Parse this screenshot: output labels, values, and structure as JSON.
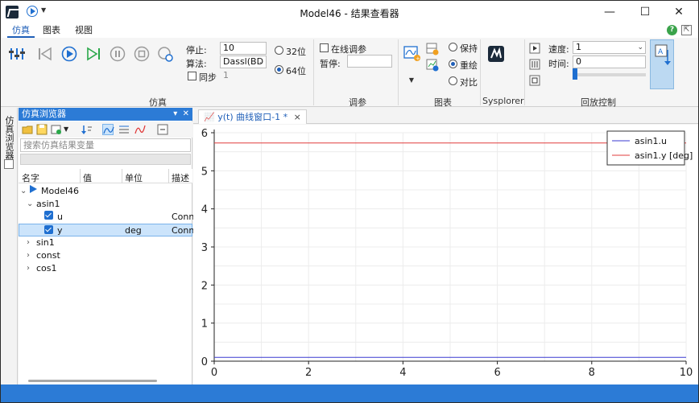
{
  "window": {
    "title": "Model46 - 结果查看器"
  },
  "title_buttons": {
    "minimize": "—",
    "maximize": "☐",
    "close": "✕"
  },
  "tabs": [
    {
      "label": "仿真",
      "active": true
    },
    {
      "label": "图表",
      "active": false
    },
    {
      "label": "视图",
      "active": false
    }
  ],
  "sim_group": {
    "label": "仿真",
    "stop_label": "停止:",
    "stop_value": "10",
    "algo_label": "算法:",
    "algo_value": "Dassl(BD",
    "sync_label": "同步",
    "sync_value": "1",
    "bit32_label": "32位",
    "bit64_label": "64位",
    "selected_bits": "64位"
  },
  "tune_group": {
    "label": "调参",
    "online_label": "在线调参",
    "pause_label": "暂停:"
  },
  "chart_group": {
    "label": "图表",
    "keep_label": "保持",
    "redraw_label": "重绘",
    "compare_label": "对比",
    "selected_mode": "重绘"
  },
  "sysplorer_group": {
    "label": "Sysplorer"
  },
  "replay_group": {
    "label": "回放控制",
    "speed_label": "速度:",
    "speed_value": "1",
    "time_label": "时间:",
    "time_value": "0",
    "time_progress": 0.0
  },
  "side_strip": {
    "label": "仿真浏览器"
  },
  "browser": {
    "title": "仿真浏览器",
    "search_placeholder": "搜索仿真结果变量",
    "columns": [
      "名字",
      "值",
      "单位",
      "描述"
    ],
    "rows": [
      {
        "name": "Model46",
        "value": "",
        "unit": "",
        "desc": "",
        "level": 0,
        "expanded": true
      },
      {
        "name": "asin1",
        "value": "",
        "unit": "",
        "desc": "",
        "level": 1,
        "expanded": true
      },
      {
        "name": "u",
        "value": "",
        "unit": "",
        "desc": "Conn",
        "level": 2,
        "checked": true
      },
      {
        "name": "y",
        "value": "",
        "unit": "deg",
        "desc": "Conn",
        "level": 2,
        "checked": true,
        "selected": true
      },
      {
        "name": "sin1",
        "level": 1,
        "expanded": false
      },
      {
        "name": "const",
        "level": 1,
        "expanded": false
      },
      {
        "name": "cos1",
        "level": 1,
        "expanded": false
      }
    ]
  },
  "plot_tab": {
    "label": "y(t) 曲线窗口-1 *",
    "close": "×"
  },
  "chart_data": {
    "type": "line",
    "xlim": [
      0,
      10
    ],
    "ylim": [
      0,
      6
    ],
    "xticks": [
      0,
      2,
      4,
      6,
      8,
      10
    ],
    "yticks": [
      0,
      1,
      2,
      3,
      4,
      5,
      6
    ],
    "grid": true,
    "legend_position": "top-right",
    "series": [
      {
        "name": "asin1.u",
        "color": "#3a3ad0",
        "x": [
          0,
          10
        ],
        "y": [
          0.1,
          0.1
        ]
      },
      {
        "name": "asin1.y [deg]",
        "color": "#e03c3c",
        "x": [
          0,
          10
        ],
        "y": [
          5.73,
          5.73
        ]
      }
    ]
  }
}
